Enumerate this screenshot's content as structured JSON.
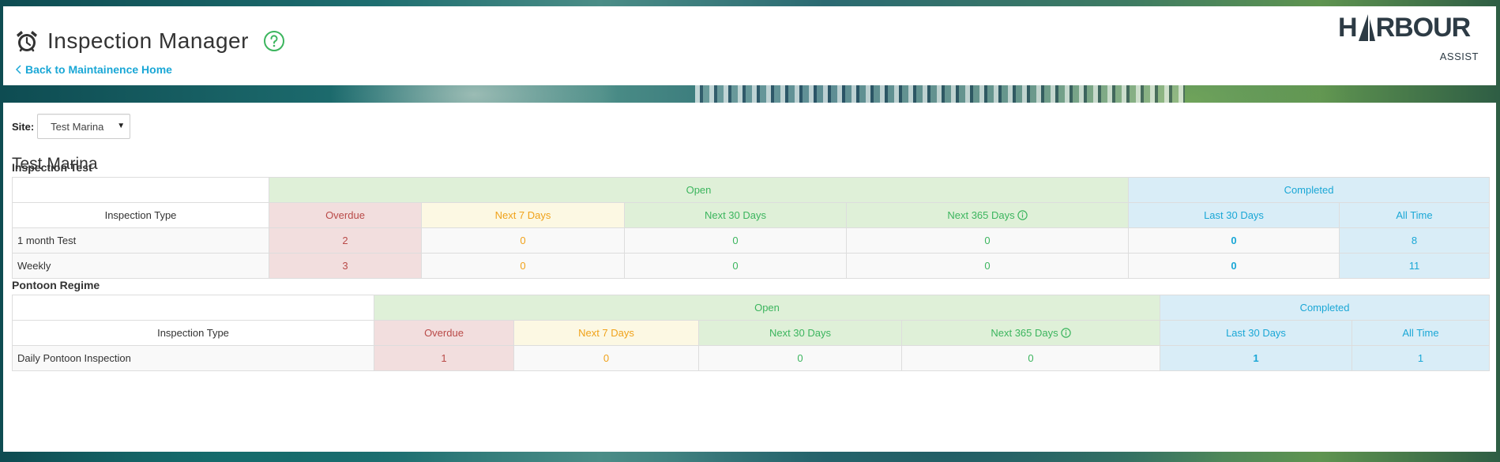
{
  "header": {
    "title": "Inspection Manager",
    "back_link": "Back to Maintainence Home",
    "logo_main_1": "H",
    "logo_main_2": "RBOUR",
    "logo_sub": "ASSIST"
  },
  "site": {
    "label": "Site:",
    "selected": "Test Marina",
    "title": "Test Marina"
  },
  "colors": {
    "open": "#3cb55e",
    "completed": "#1aa7d6",
    "overdue": "#b94a48",
    "next7": "#f0a21a"
  },
  "columns": {
    "open": "Open",
    "completed": "Completed",
    "type": "Inspection Type",
    "overdue": "Overdue",
    "next7": "Next 7 Days",
    "next30": "Next 30 Days",
    "next365": "Next 365 Days",
    "last30": "Last 30 Days",
    "all": "All Time"
  },
  "regimes": [
    {
      "name": "Inspection Test",
      "rows": [
        {
          "type": "1 month Test",
          "overdue": "2",
          "next7": "0",
          "next30": "0",
          "next365": "0",
          "last30": "0",
          "all": "8"
        },
        {
          "type": "Weekly",
          "overdue": "3",
          "next7": "0",
          "next30": "0",
          "next365": "0",
          "last30": "0",
          "all": "11"
        }
      ]
    },
    {
      "name": "Pontoon Regime",
      "rows": [
        {
          "type": "Daily Pontoon Inspection",
          "overdue": "1",
          "next7": "0",
          "next30": "0",
          "next365": "0",
          "last30": "1",
          "all": "1"
        }
      ]
    }
  ]
}
